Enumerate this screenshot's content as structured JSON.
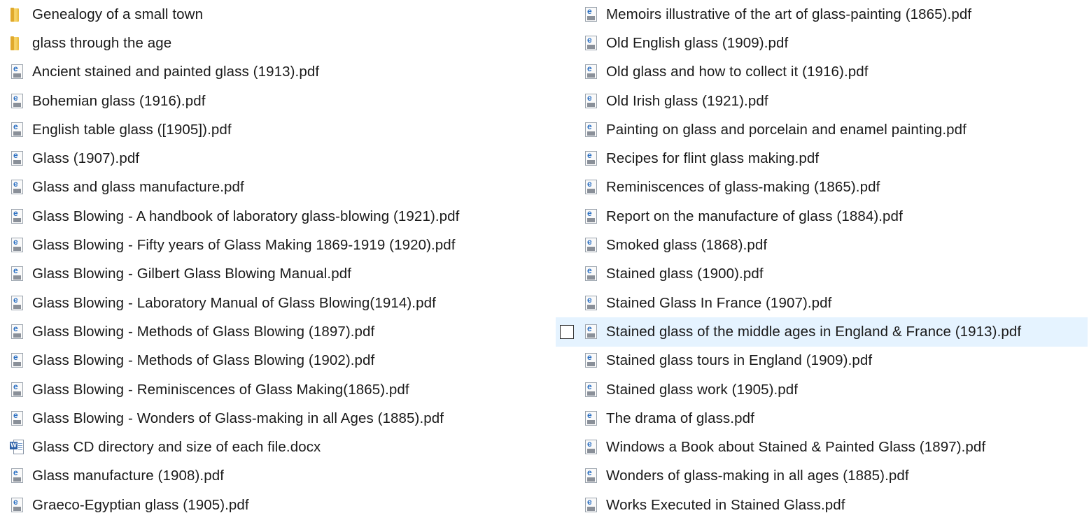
{
  "left_column": [
    {
      "name": "Genealogy of a small town",
      "type": "folder-icon"
    },
    {
      "name": "glass through the age",
      "type": "folder-icon"
    },
    {
      "name": "Ancient stained and painted glass (1913).pdf",
      "type": "pdf-icon"
    },
    {
      "name": "Bohemian glass (1916).pdf",
      "type": "pdf-icon"
    },
    {
      "name": "English table glass ([1905]).pdf",
      "type": "pdf-icon"
    },
    {
      "name": "Glass (1907).pdf",
      "type": "pdf-icon"
    },
    {
      "name": "Glass and glass manufacture.pdf",
      "type": "pdf-icon"
    },
    {
      "name": "Glass Blowing - A handbook of laboratory glass-blowing (1921).pdf",
      "type": "pdf-icon"
    },
    {
      "name": "Glass Blowing - Fifty years of Glass Making 1869-1919 (1920).pdf",
      "type": "pdf-icon"
    },
    {
      "name": "Glass Blowing - Gilbert Glass Blowing Manual.pdf",
      "type": "pdf-icon"
    },
    {
      "name": "Glass Blowing - Laboratory Manual of Glass Blowing(1914).pdf",
      "type": "pdf-icon"
    },
    {
      "name": "Glass Blowing - Methods of Glass Blowing (1897).pdf",
      "type": "pdf-icon"
    },
    {
      "name": "Glass Blowing - Methods of Glass Blowing (1902).pdf",
      "type": "pdf-icon"
    },
    {
      "name": "Glass Blowing - Reminiscences of Glass Making(1865).pdf",
      "type": "pdf-icon"
    },
    {
      "name": "Glass Blowing - Wonders of Glass-making in all Ages (1885).pdf",
      "type": "pdf-icon"
    },
    {
      "name": "Glass CD directory and size of each file.docx",
      "type": "word-doc-icon"
    },
    {
      "name": "Glass manufacture (1908).pdf",
      "type": "pdf-icon"
    },
    {
      "name": "Graeco-Egyptian glass (1905).pdf",
      "type": "pdf-icon"
    }
  ],
  "right_column": [
    {
      "name": "Memoirs illustrative of the art of glass-painting (1865).pdf",
      "type": "pdf-icon"
    },
    {
      "name": "Old English glass (1909).pdf",
      "type": "pdf-icon"
    },
    {
      "name": "Old glass and how to collect it (1916).pdf",
      "type": "pdf-icon"
    },
    {
      "name": "Old Irish glass (1921).pdf",
      "type": "pdf-icon"
    },
    {
      "name": "Painting on glass and porcelain and enamel painting.pdf",
      "type": "pdf-icon"
    },
    {
      "name": "Recipes for flint glass making.pdf",
      "type": "pdf-icon"
    },
    {
      "name": "Reminiscences of glass-making (1865).pdf",
      "type": "pdf-icon"
    },
    {
      "name": "Report on the manufacture of glass (1884).pdf",
      "type": "pdf-icon"
    },
    {
      "name": "Smoked glass (1868).pdf",
      "type": "pdf-icon"
    },
    {
      "name": "Stained glass (1900).pdf",
      "type": "pdf-icon"
    },
    {
      "name": "Stained Glass In France (1907).pdf",
      "type": "pdf-icon"
    },
    {
      "name": "Stained glass of the middle ages in England & France (1913).pdf",
      "type": "pdf-icon",
      "hovered": true,
      "checked": false
    },
    {
      "name": "Stained glass tours in England (1909).pdf",
      "type": "pdf-icon"
    },
    {
      "name": "Stained glass work (1905).pdf",
      "type": "pdf-icon"
    },
    {
      "name": "The drama of glass.pdf",
      "type": "pdf-icon"
    },
    {
      "name": "Windows a Book about Stained & Painted Glass (1897).pdf",
      "type": "pdf-icon"
    },
    {
      "name": "Wonders of glass-making in all ages (1885).pdf",
      "type": "pdf-icon"
    },
    {
      "name": "Works Executed in Stained Glass.pdf",
      "type": "pdf-icon"
    }
  ],
  "colors": {
    "hover_background": "#e5f3ff",
    "text": "#1a1a1a",
    "folder": "#f2c547",
    "pdf_accent": "#2a6fc2",
    "word_accent": "#2b5fa8"
  }
}
